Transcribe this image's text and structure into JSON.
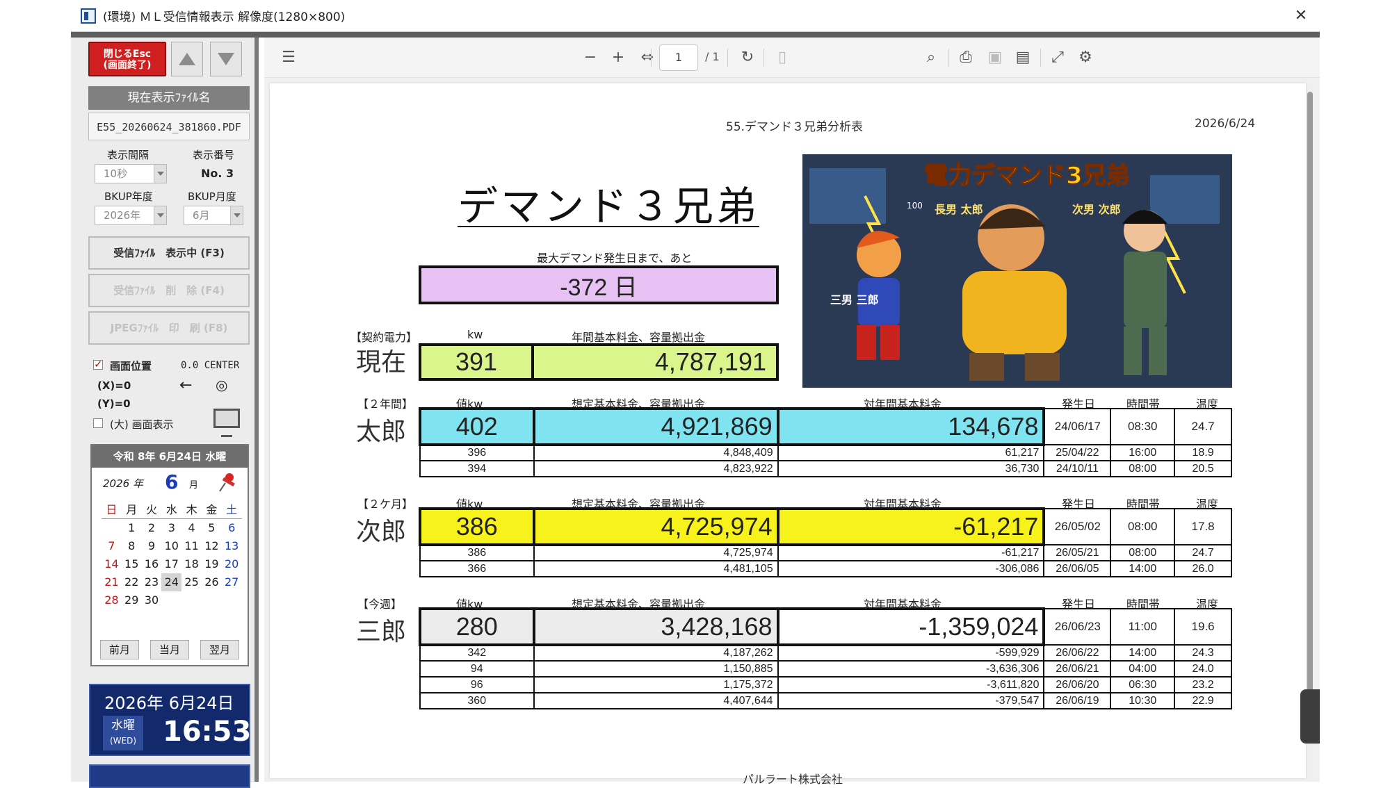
{
  "window": {
    "title": "(環境) ＭＬ受信情報表示 解像度(1280×800)"
  },
  "left": {
    "close_btn": "閉じるEsc\n(画面終了)",
    "current_file_label": "現在表示ﾌｧｲﾙ名",
    "current_file": "E55_20260624_381860.PDF",
    "interval_label": "表示間隔",
    "interval_value": "10秒",
    "number_label": "表示番号",
    "number_value": "No. 3",
    "bkup_year_label": "BKUP年度",
    "bkup_year_value": "2026年",
    "bkup_month_label": "BKUP月度",
    "bkup_month_value": "6月",
    "btn_recv": "受信ﾌｧｲﾙ　表示中 (F3)",
    "btn_delete": "受信ﾌｧｲﾙ　削　除 (F4)",
    "btn_print": "JPEGﾌｧｲﾙ　印　刷 (F8)",
    "pos_label": "画面位置",
    "pos_value": "0.0 CENTER",
    "x_label": "(X)=0",
    "y_label": "(Y)=0",
    "arrow": "←",
    "target": "◎",
    "big_label": "(大) 画面表示"
  },
  "calendar": {
    "header": "令和 8年 6月24日 水曜",
    "year": "2026 年",
    "month": "6",
    "month_suffix": "月",
    "weekdays": [
      "日",
      "月",
      "火",
      "水",
      "木",
      "金",
      "土"
    ],
    "weeks": [
      [
        "",
        "1",
        "2",
        "3",
        "4",
        "5",
        "6"
      ],
      [
        "7",
        "8",
        "9",
        "10",
        "11",
        "12",
        "13"
      ],
      [
        "14",
        "15",
        "16",
        "17",
        "18",
        "19",
        "20"
      ],
      [
        "21",
        "22",
        "23",
        "24",
        "25",
        "26",
        "27"
      ],
      [
        "28",
        "29",
        "30",
        "",
        "",
        "",
        ""
      ]
    ],
    "today": "24",
    "prev": "前月",
    "current": "当月",
    "next": "翌月"
  },
  "clock": {
    "date": "2026年 6月24日",
    "weekday": "水曜",
    "weekday_en": "(WED)",
    "time": "16:53"
  },
  "viewer": {
    "page": "1",
    "total": "/ 1"
  },
  "doc": {
    "header": "55.デマンド３兄弟分析表",
    "date": "2026/6/24",
    "title": "デマンド３兄弟",
    "countdown_label": "最大デマンド発生日まで、あと",
    "countdown_value": "-372 日",
    "col_kw": "kw",
    "col_value_kw": "値kw",
    "col_annual": "年間基本料金、容量拠出金",
    "col_assumed": "想定基本料金、容量拠出金",
    "col_vs": "対年間基本料金",
    "col_date": "発生日",
    "col_time": "時間帯",
    "col_temp": "温度",
    "footer": "パルラート株式会社",
    "contract": {
      "tag": "【契約電力】",
      "name": "現在",
      "kw": "391",
      "annual": "4,787,191"
    },
    "taro": {
      "tag": "【２年間】",
      "name": "太郎",
      "main": {
        "kw": "402",
        "amount": "4,921,869",
        "diff": "134,678",
        "date": "24/06/17",
        "time": "08:30",
        "temp": "24.7"
      },
      "rows": [
        {
          "kw": "396",
          "amount": "4,848,409",
          "diff": "61,217",
          "date": "25/04/22",
          "time": "16:00",
          "temp": "18.9"
        },
        {
          "kw": "394",
          "amount": "4,823,922",
          "diff": "36,730",
          "date": "24/10/11",
          "time": "08:00",
          "temp": "20.5"
        }
      ]
    },
    "jiro": {
      "tag": "【２ケ月】",
      "name": "次郎",
      "main": {
        "kw": "386",
        "amount": "4,725,974",
        "diff": "-61,217",
        "date": "26/05/02",
        "time": "08:00",
        "temp": "17.8"
      },
      "rows": [
        {
          "kw": "386",
          "amount": "4,725,974",
          "diff": "-61,217",
          "date": "26/05/21",
          "time": "08:00",
          "temp": "24.7"
        },
        {
          "kw": "366",
          "amount": "4,481,105",
          "diff": "-306,086",
          "date": "26/06/05",
          "time": "14:00",
          "temp": "26.0"
        }
      ]
    },
    "saburo": {
      "tag": "【今週】",
      "name": "三郎",
      "main": {
        "kw": "280",
        "amount": "3,428,168",
        "diff": "-1,359,024",
        "date": "26/06/23",
        "time": "11:00",
        "temp": "19.6"
      },
      "rows": [
        {
          "kw": "342",
          "amount": "4,187,262",
          "diff": "-599,929",
          "date": "26/06/22",
          "time": "14:00",
          "temp": "24.3"
        },
        {
          "kw": "94",
          "amount": "1,150,885",
          "diff": "-3,636,306",
          "date": "26/06/21",
          "time": "04:00",
          "temp": "24.0"
        },
        {
          "kw": "96",
          "amount": "1,175,372",
          "diff": "-3,611,820",
          "date": "26/06/20",
          "time": "06:30",
          "temp": "23.2"
        },
        {
          "kw": "360",
          "amount": "4,407,644",
          "diff": "-379,547",
          "date": "26/06/19",
          "time": "10:30",
          "temp": "22.9"
        }
      ]
    },
    "art_title": "電力デマンド3兄弟",
    "art_labels": {
      "taro": "長男 太郎",
      "jiro": "次男 次郎",
      "saburo": "三男 三郎",
      "plate": "100"
    },
    "colors": {
      "countdown": "#e8c2f5",
      "contract": "#d9f58c",
      "taro": "#7fe3f0",
      "jiro": "#f7f21c",
      "saburo": "#ececec"
    }
  }
}
